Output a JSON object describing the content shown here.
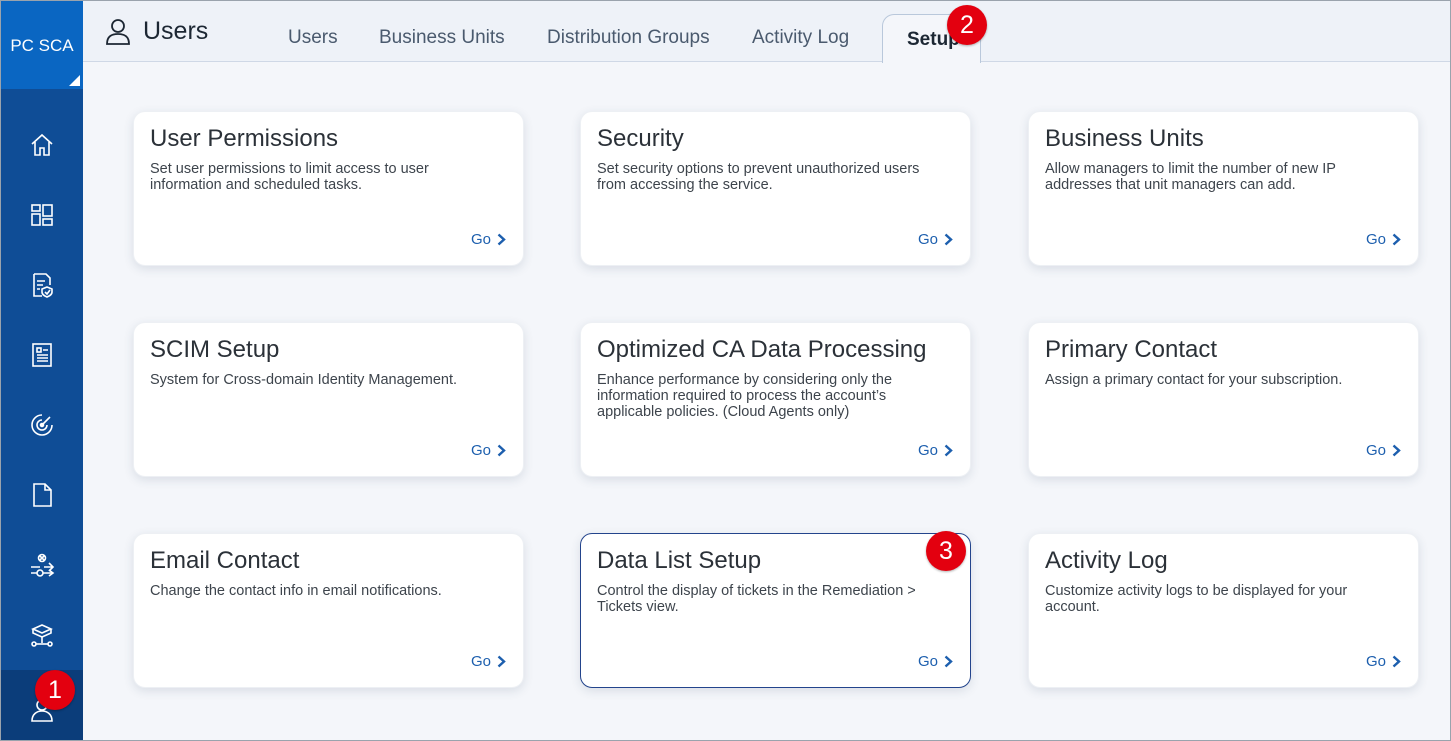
{
  "app": {
    "badge": "PC SCA"
  },
  "header": {
    "title": "Users",
    "tabs": [
      {
        "label": "Users"
      },
      {
        "label": "Business Units"
      },
      {
        "label": "Distribution Groups"
      },
      {
        "label": "Activity Log"
      },
      {
        "label": "Setup",
        "active": true
      }
    ]
  },
  "sidebar": {
    "icons": [
      "home-icon",
      "dashboard-icon",
      "policy-report-icon",
      "checklist-icon",
      "scan-target-icon",
      "document-icon",
      "remediation-icon",
      "assets-icon",
      "user-icon"
    ]
  },
  "callouts": [
    "1",
    "2",
    "3"
  ],
  "cards": [
    {
      "title": "User Permissions",
      "description": "Set user permissions to limit access to user information and scheduled tasks.",
      "action": "Go"
    },
    {
      "title": "Security",
      "description": "Set security options to prevent unauthorized users from accessing the service.",
      "action": "Go"
    },
    {
      "title": "Business Units",
      "description": "Allow managers to limit the number of new IP addresses that unit managers can add.",
      "action": "Go"
    },
    {
      "title": "SCIM Setup",
      "description": "System for Cross-domain Identity Management.",
      "action": "Go"
    },
    {
      "title": "Optimized CA Data Processing",
      "description": "Enhance performance by considering only the information required to process the account’s applicable policies. (Cloud Agents only)",
      "action": "Go"
    },
    {
      "title": "Primary Contact",
      "description": "Assign a primary contact for your subscription.",
      "action": "Go"
    },
    {
      "title": "Email Contact",
      "description": "Change the contact info in email notifications.",
      "action": "Go"
    },
    {
      "title": "Data List Setup",
      "description": "Control the display of tickets in the Remediation > Tickets view.",
      "action": "Go",
      "highlighted": true
    },
    {
      "title": "Activity Log",
      "description": "Customize activity logs to be displayed for your account.",
      "action": "Go"
    }
  ],
  "colors": {
    "sidebar": "#0f4d96",
    "badge": "#0a66c2",
    "callout": "#e3000f",
    "link": "#1d5fae",
    "highlight_border": "#23448c"
  }
}
